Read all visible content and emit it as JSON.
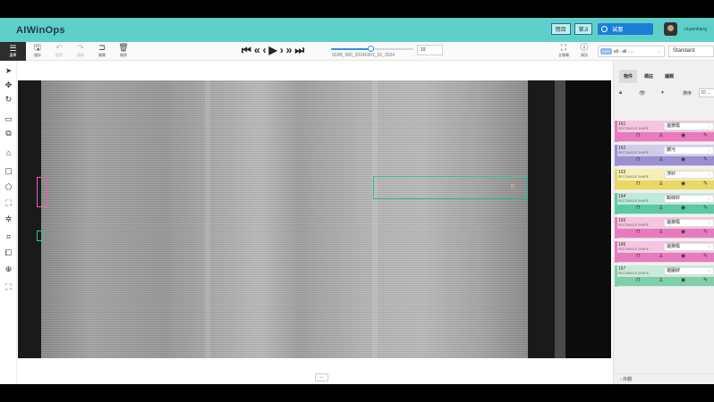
{
  "app": {
    "title": "AIWinOps"
  },
  "header": {
    "lang_buttons": [
      "簡目",
      "繁JI"
    ],
    "mode_label": "試層",
    "username": "i.luyenhang"
  },
  "toolbar": {
    "menu_label": "選單",
    "actions": [
      {
        "icon": "save-icon",
        "glyph": "🖫",
        "label": "儲存",
        "enabled": true
      },
      {
        "icon": "undo-icon",
        "glyph": "↶",
        "label": "復原",
        "enabled": false
      },
      {
        "icon": "redo-icon",
        "glyph": "↷",
        "label": "重做",
        "enabled": false
      },
      {
        "icon": "exit-icon",
        "glyph": "⊐",
        "label": "離開",
        "enabled": true
      },
      {
        "icon": "delete-icon",
        "glyph": "🗑",
        "label": "刪除",
        "enabled": true
      }
    ],
    "player": {
      "buttons": [
        "⏮",
        "«",
        "‹",
        "▶",
        "›",
        "»",
        "⏭"
      ],
      "progress": 0.48,
      "frame_name": "503B_080_20240301_01_2024",
      "frame_number": "19"
    },
    "fullscreen_label": "全螢幕",
    "info_label": "資訊",
    "filter": {
      "badge": "0452",
      "text": "all - all - ..."
    },
    "view_mode": "Standard"
  },
  "left_tools": [
    {
      "icon": "cursor-icon",
      "glyph": "➤"
    },
    {
      "icon": "move-icon",
      "glyph": "✥"
    },
    {
      "icon": "rotate-icon",
      "glyph": "↻"
    },
    {
      "icon": "fit-icon",
      "glyph": "▭"
    },
    {
      "icon": "zoom-region-icon",
      "glyph": "⧉"
    },
    {
      "icon": "tag-icon",
      "glyph": "⌂"
    },
    {
      "icon": "rectangle-icon",
      "glyph": "▢"
    },
    {
      "icon": "polygon-icon",
      "glyph": "⬠"
    },
    {
      "icon": "split-icon",
      "glyph": "⛶"
    },
    {
      "icon": "magic-wand-icon",
      "glyph": "✲"
    },
    {
      "icon": "crop-icon",
      "glyph": "⌗"
    },
    {
      "icon": "group-icon",
      "glyph": "⧠"
    },
    {
      "icon": "zoom-icon",
      "glyph": "⊕"
    },
    {
      "icon": "fit-screen-icon",
      "glyph": "⛶"
    }
  ],
  "panel": {
    "tabs": [
      "物件",
      "標註",
      "議題"
    ],
    "sort_label": "排序",
    "sort_value": "ID ...",
    "objects": [
      {
        "id": "161",
        "type": "RECTANGLE SHAPE",
        "label": "邊損傷",
        "color": "#e77bbd",
        "bg": "#f4c6e1"
      },
      {
        "id": "162",
        "type": "RECTANGLE SHAPE",
        "label": "髒污",
        "color": "#9b8fcf",
        "bg": "#d2cbe9"
      },
      {
        "id": "163",
        "type": "RECTANGLE SHAPE",
        "label": "浮紗",
        "color": "#e8d866",
        "bg": "#f6efb7"
      },
      {
        "id": "164",
        "type": "RECTANGLE SHAPE",
        "label": "斷緯紗",
        "color": "#5cc9a5",
        "bg": "#bfe9db"
      },
      {
        "id": "165",
        "type": "RECTANGLE SHAPE",
        "label": "邊損傷",
        "color": "#e77bbd",
        "bg": "#f4c6e1"
      },
      {
        "id": "166",
        "type": "RECTANGLE SHAPE",
        "label": "邊損傷",
        "color": "#e77bbd",
        "bg": "#f4c6e1"
      },
      {
        "id": "167",
        "type": "RECTANGLE SHAPE",
        "label": "邊圖狀",
        "color": "#7fcfa8",
        "bg": "#cbead9"
      }
    ],
    "footer": "外觀"
  }
}
